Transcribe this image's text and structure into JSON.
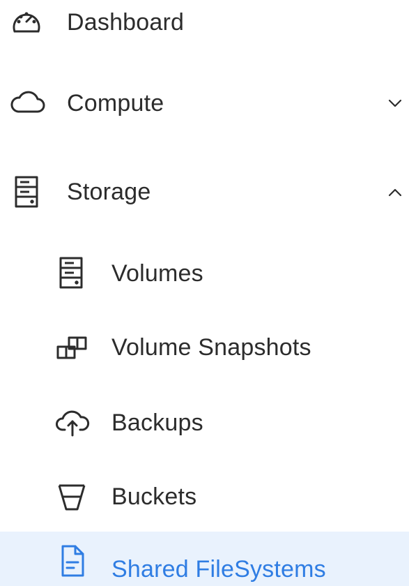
{
  "sidebar": {
    "items": [
      {
        "label": "Dashboard",
        "icon": "dashboard-gauge-icon"
      },
      {
        "label": "Compute",
        "icon": "cloud-icon",
        "expanded": false
      },
      {
        "label": "Storage",
        "icon": "storage-server-icon",
        "expanded": true,
        "children": [
          {
            "label": "Volumes",
            "icon": "volume-server-icon"
          },
          {
            "label": "Volume Snapshots",
            "icon": "snapshot-blocks-icon"
          },
          {
            "label": "Backups",
            "icon": "cloud-upload-icon"
          },
          {
            "label": "Buckets",
            "icon": "bucket-icon"
          },
          {
            "label": "Shared FileSystems",
            "icon": "file-icon",
            "active": true
          }
        ]
      }
    ]
  },
  "colors": {
    "text": "#2c2c2c",
    "active_text": "#2f7de3",
    "active_bg": "#e9f2fd"
  }
}
